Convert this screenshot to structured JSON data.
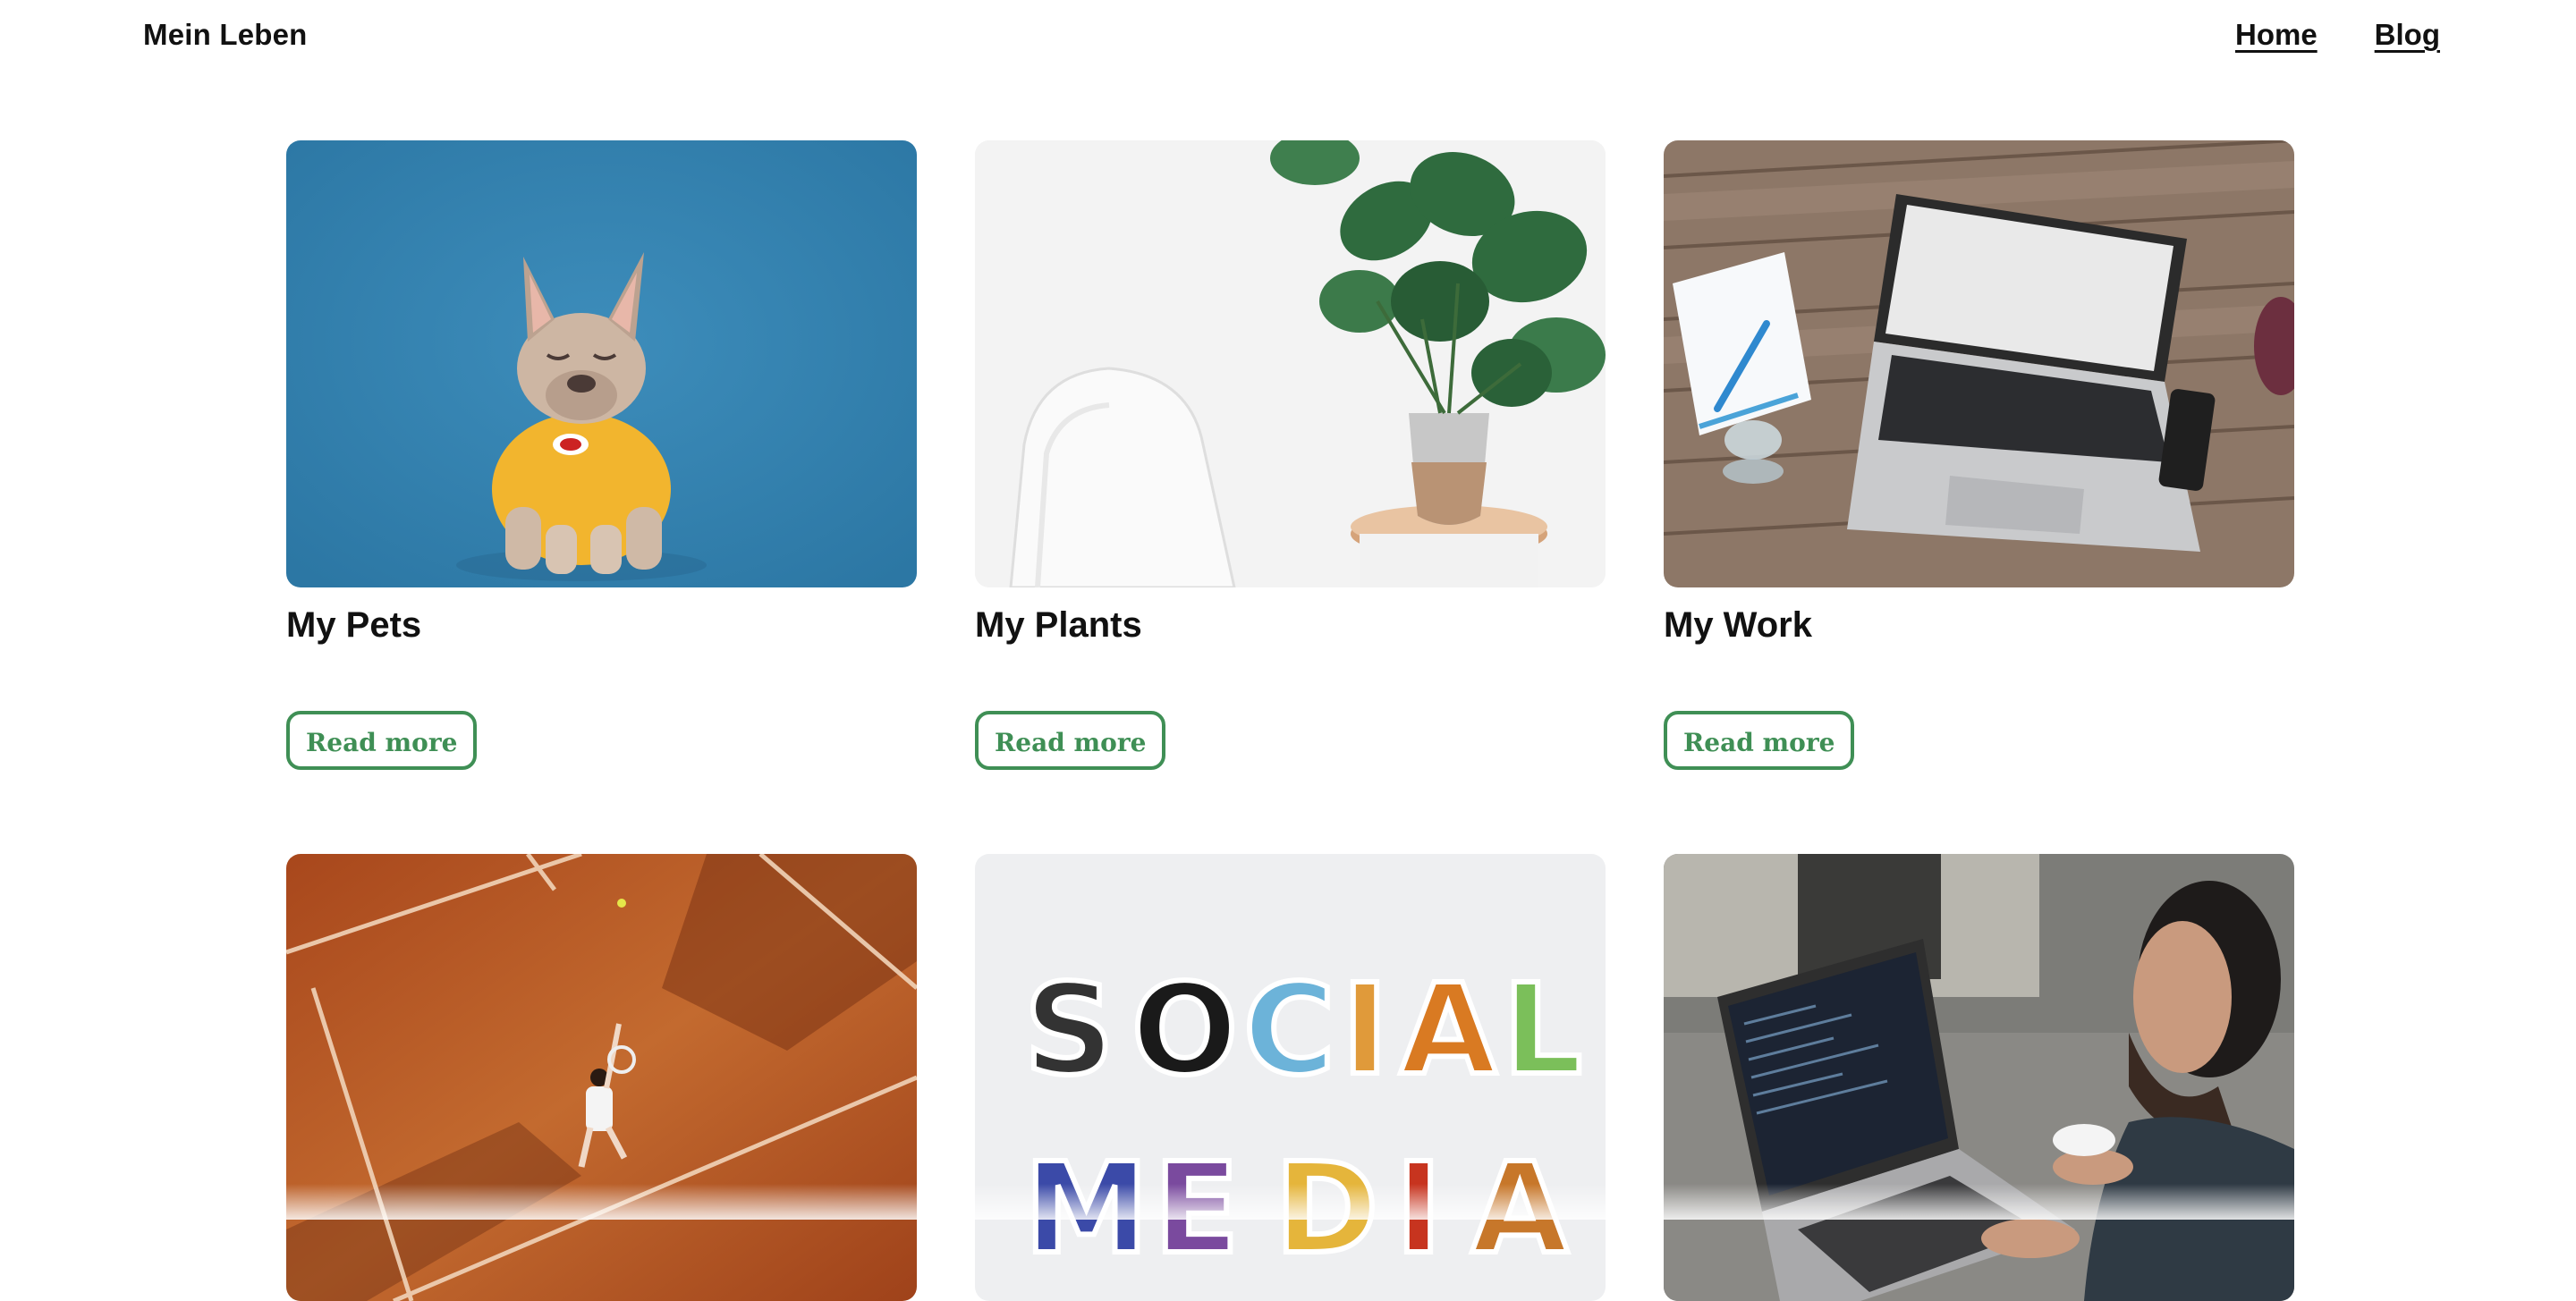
{
  "header": {
    "brand": "Mein Leben",
    "nav": [
      {
        "label": "Home"
      },
      {
        "label": "Blog"
      }
    ]
  },
  "cards": [
    {
      "title": "My Pets",
      "button": "Read more",
      "image": "french-bulldog-photo"
    },
    {
      "title": "My Plants",
      "button": "Read more",
      "image": "monstera-plant-photo"
    },
    {
      "title": "My Work",
      "button": "Read more",
      "image": "laptop-desk-photo"
    },
    {
      "title": "",
      "button": "",
      "image": "tennis-court-photo"
    },
    {
      "title": "",
      "button": "",
      "image": "social-media-letters-photo"
    },
    {
      "title": "",
      "button": "",
      "image": "man-coding-laptop-photo"
    }
  ],
  "social_media_letters": {
    "line1": [
      "S",
      "O",
      "C",
      "I",
      "A",
      "L"
    ],
    "line2": [
      "M",
      "E",
      "D",
      "I",
      "A"
    ]
  },
  "colors": {
    "accent_green": "#3f8f55",
    "text": "#111111",
    "background": "#ffffff"
  }
}
